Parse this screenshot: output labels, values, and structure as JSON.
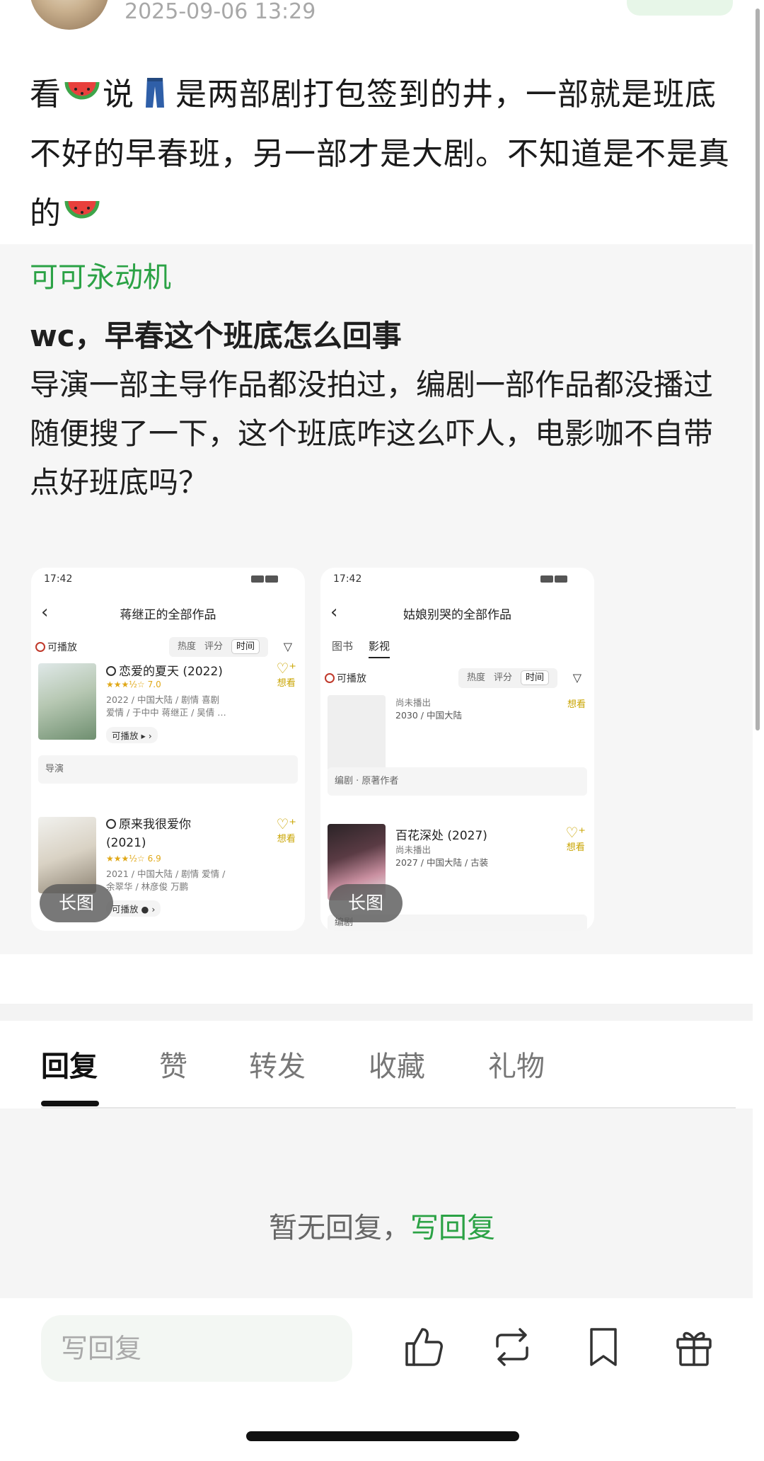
{
  "post": {
    "time": "2025-09-06 13:29",
    "text_parts": [
      "看",
      "说",
      "是两部剧打包签到的井，一部就是班底不好的早春班，另一部才是大剧。不知道是不是真的"
    ]
  },
  "quote": {
    "author": "可可永动机",
    "line1": "wc，早春这个班底怎么回事",
    "line2": "导演一部主导作品都没拍过，编剧一部作品都没播过",
    "line3": "随便搜了一下，这个班底咋这么吓人，电影咖不自带点好班底吗？"
  },
  "thumb1": {
    "time": "17:42",
    "title": "蒋继正的全部作品",
    "play_filter": "可播放",
    "sort_hot": "热度",
    "sort_score": "评分",
    "sort_time": "时间",
    "movie1_title": "恋爱的夏天 (2022)",
    "movie1_score": "7.0",
    "movie1_meta1": "2022 / 中国大陆 / 剧情 喜剧",
    "movie1_meta2": "爱情 / 于中中 蒋继正 / 吴倩 …",
    "movie1_pill": "可播放",
    "want": "想看",
    "role1": "导演",
    "movie2_title": "原来我很爱你",
    "movie2_year": "(2021)",
    "movie2_score": "6.9",
    "movie2_meta1": "2021 / 中国大陆 / 剧情 爱情 /",
    "movie2_meta2": "余翠华 / 林彦俊 万鹏",
    "movie2_pill": "可播放",
    "long_tag": "长图"
  },
  "thumb2": {
    "time": "17:42",
    "title": "姑娘别哭的全部作品",
    "tab_books": "图书",
    "tab_video": "影视",
    "play_filter": "可播放",
    "sort_hot": "热度",
    "sort_score": "评分",
    "sort_time": "时间",
    "item1_status": "尚未播出",
    "item1_meta": "2030 / 中国大陆",
    "want": "想看",
    "role1": "编剧 · 原著作者",
    "item2_title": "百花深处 (2027)",
    "item2_status": "尚未播出",
    "item2_meta": "2027 / 中国大陆 / 古装",
    "role2": "编剧",
    "long_tag": "长图"
  },
  "tabs": {
    "reply": "回复",
    "like": "赞",
    "repost": "转发",
    "favorite": "收藏",
    "gift": "礼物"
  },
  "empty": {
    "message": "暂无回复，",
    "action": "写回复"
  },
  "bottom": {
    "reply_placeholder": "写回复"
  },
  "colors": {
    "accent_green": "#2ba245",
    "rating_gold": "#e0a817"
  }
}
